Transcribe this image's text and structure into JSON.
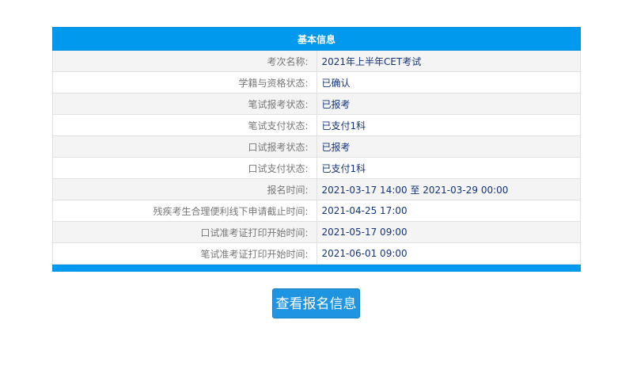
{
  "table": {
    "header": "基本信息",
    "rows": [
      {
        "label": "考次名称:",
        "value": "2021年上半年CET考试"
      },
      {
        "label": "学籍与资格状态:",
        "value": "已确认"
      },
      {
        "label": "笔试报考状态:",
        "value": "已报考"
      },
      {
        "label": "笔试支付状态:",
        "value": "已支付1科"
      },
      {
        "label": "口试报考状态:",
        "value": "已报考"
      },
      {
        "label": "口试支付状态:",
        "value": "已支付1科"
      },
      {
        "label": "报名时间:",
        "value": "2021-03-17 14:00 至 2021-03-29 00:00"
      },
      {
        "label": "残疾考生合理便利线下申请截止时间:",
        "value": "2021-04-25 17:00"
      },
      {
        "label": "口试准考证打印开始时间:",
        "value": "2021-05-17 09:00"
      },
      {
        "label": "笔试准考证打印开始时间:",
        "value": "2021-06-01 09:00"
      }
    ]
  },
  "button": {
    "label": "查看报名信息"
  },
  "colors": {
    "header_bg": "#0099ee",
    "button_bg": "#1f94e0",
    "value_text": "#14347a",
    "label_text": "#777777"
  }
}
